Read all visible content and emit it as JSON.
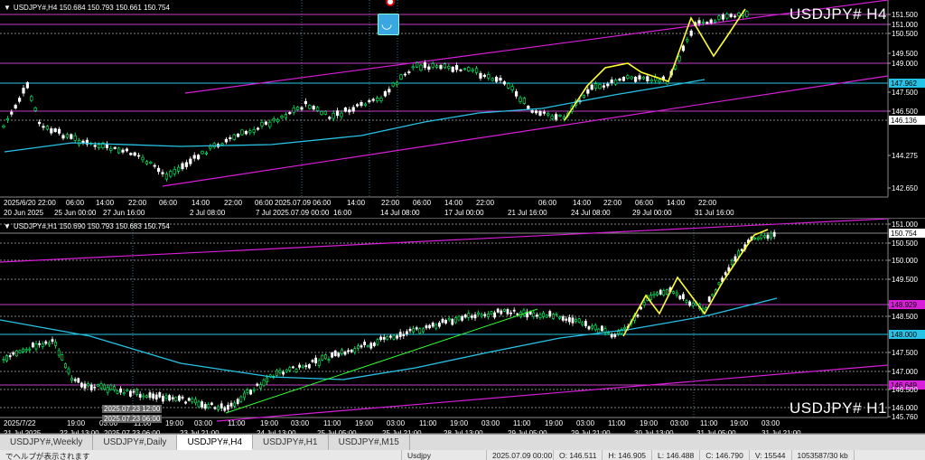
{
  "colors": {
    "bg": "#000000",
    "bull": "#00ff66",
    "bear": "#ffffff",
    "ma": "#27c3e6",
    "channel": "#d81ed8",
    "hline": "#d81ed8",
    "cyanline": "#27c3e6",
    "zigzag": "#ffff33",
    "trend": "#33ff33"
  },
  "h4": {
    "header": "USDJPY#,H4  150.684 150.793 150.661 150.754",
    "label": "USDJPY#  H4",
    "price_axis": [
      "151.500",
      "151.000",
      "150.500",
      "149.500",
      "149.000",
      "147.962",
      "147.500",
      "146.500",
      "146.136",
      "144.275",
      "142.650"
    ],
    "highlight_prices": [
      {
        "text": "147.962",
        "bg": "#27c3e6"
      },
      {
        "text": "146.136",
        "bg": "#ffffff"
      },
      {
        "text": "150.754",
        "bg": "#ffffff"
      }
    ],
    "time_top": [
      "2025/6/20 22:00",
      "06:00",
      "14:00",
      "22:00",
      "06:00",
      "14:00",
      "22:00",
      "06:00",
      "2025.07.09 06:00",
      "06:00",
      "14:00",
      "22:00",
      "06:00",
      "14:00",
      "22:00",
      "06:00",
      "14:00",
      "22:00",
      "06:00",
      "14:00",
      "22:00"
    ],
    "time_bottom": [
      "20 Jun 2025",
      "25 Jun 00:00",
      "27 Jun 16:00",
      "2 Jul 08:00",
      "7 Jul",
      "2025.07.09 00:00",
      "16:00",
      "14 Jul 08:00",
      "17 Jul 00:00",
      "21 Jul 16:00",
      "24 Jul 08:00",
      "29 Jul 00:00",
      "31 Jul 16:00"
    ]
  },
  "h1": {
    "header": "USDJPY#,H1  150.690 150.793 150.683 150.754",
    "label": "USDJPY#  H1",
    "price_axis": [
      "151.000",
      "150.754",
      "150.500",
      "150.000",
      "149.500",
      "149.000",
      "148.929",
      "148.500",
      "148.000",
      "147.500",
      "147.000",
      "146.649",
      "146.500",
      "146.000",
      "145.760"
    ],
    "time_top": [
      "2025/7/22",
      "19:00",
      "03:00",
      "11:00",
      "19:00",
      "03:00",
      "11:00",
      "19:00",
      "03:00",
      "11:00",
      "19:00",
      "03:00",
      "11:00",
      "19:00",
      "03:00",
      "11:00",
      "19:00",
      "03:00",
      "11:00",
      "19:00",
      "03:00",
      "11:00",
      "19:00",
      "03:00",
      "11:00",
      "19:00",
      "03:00"
    ],
    "time_bottom": [
      "21 Jul 2025",
      "22 Jul 13:00",
      "2025.07.23 06:00",
      "23 Jul 21:00",
      "24 Jul 13:00",
      "25 Jul 05:00",
      "25 Jul 21:00",
      "28 Jul 13:00",
      "29 Jul 05:00",
      "29 Jul 21:00",
      "30 Jul 13:00",
      "31 Jul 05:00",
      "31 Jul 21:00"
    ],
    "crosshair_labels": [
      "2025.07.23 12:00",
      "2025.07.23 06:00"
    ]
  },
  "tabs": [
    {
      "label": "USDJPY#,Weekly",
      "active": false
    },
    {
      "label": "USDJPY#,Daily",
      "active": false
    },
    {
      "label": "USDJPY#,H4",
      "active": true
    },
    {
      "label": "USDJPY#,H1",
      "active": false
    },
    {
      "label": "USDJPY#,M15",
      "active": false
    }
  ],
  "status": {
    "help": "でヘルプが表示されます",
    "profile": "Usdjpy",
    "datetime": "2025.07.09 00:00",
    "open": "O: 146.511",
    "high": "H: 146.905",
    "low": "L: 146.488",
    "close": "C: 146.790",
    "volume": "V: 15544",
    "traffic": "1053587/30 kb"
  },
  "icons": {
    "smile_button": "smile-icon",
    "tab_triangle": "triangle-down-icon"
  }
}
